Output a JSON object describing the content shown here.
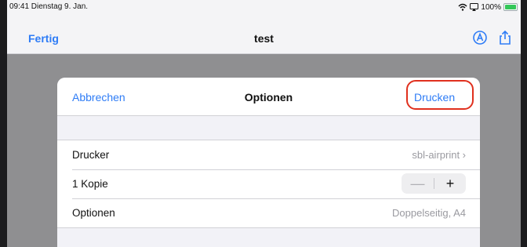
{
  "status_bar": {
    "time_date": "09:41  Dienstag 9. Jan.",
    "battery": "100%"
  },
  "navbar": {
    "done_label": "Fertig",
    "title": "test",
    "icons": [
      "markup-icon",
      "share-icon"
    ]
  },
  "print_options": {
    "cancel_label": "Abbrechen",
    "title": "Optionen",
    "print_label": "Drucken",
    "rows": [
      {
        "label": "Drucker",
        "value": "sbl-airprint ›"
      },
      {
        "label": "1 Kopie",
        "stepper": {
          "minus": "—",
          "plus": "+"
        }
      },
      {
        "label": "Optionen",
        "value": "Doppelseitig, A4"
      }
    ]
  },
  "colors": {
    "accent": "#2e7cf6",
    "highlight_ring": "#e0301e",
    "backdrop": "#8f8f91"
  }
}
